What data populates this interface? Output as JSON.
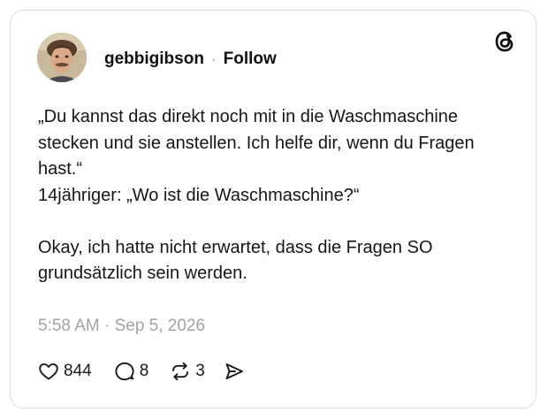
{
  "post": {
    "author": {
      "username": "gebbigibson",
      "separator": "·",
      "follow_label": "Follow",
      "avatar": "profile-photo"
    },
    "logo": "threads-logo-icon",
    "text_lines": [
      "„Du kannst das direkt noch mit in die Waschmaschine stecken und sie anstellen. Ich helfe dir, wenn du Fragen hast.“",
      "14jähriger: „Wo ist die Waschmaschine?“",
      "Okay, ich hatte nicht erwartet, dass die Fragen SO grundsätzlich sein werden."
    ],
    "timestamp": "5:58 AM · Sep 5, 2026",
    "actions": {
      "likes": "844",
      "replies": "8",
      "reposts": "3",
      "like_icon": "heart-icon",
      "reply_icon": "speech-bubble-icon",
      "repost_icon": "repost-icon",
      "share_icon": "send-icon"
    }
  },
  "colors": {
    "text": "#101010",
    "muted": "#a3a3a3",
    "border": "#dcdcdc",
    "background": "#ffffff"
  }
}
